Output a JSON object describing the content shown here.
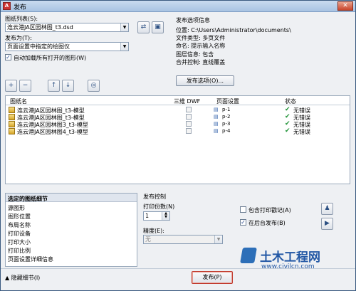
{
  "window": {
    "title": "发布",
    "close_glyph": "✕"
  },
  "sheet_list": {
    "label": "图纸列表(S):",
    "value": "连云港JA区园林图_t3.dsd"
  },
  "publish_to": {
    "label": "发布为(T):",
    "value": "页面设置中指定的绘图仪"
  },
  "auto_load": {
    "label": "自动加载所有打开的图形(W)",
    "checked": true
  },
  "info": {
    "title": "发布选项信息",
    "lines": [
      "位置: C:\\Users\\Administrator\\documents\\",
      "文件类型: 多页文件",
      "命名: 提示输入名称",
      "图层信息: 包含",
      "合并控制: 直线覆盖"
    ],
    "options_button": "发布选项(O)..."
  },
  "table": {
    "headers": [
      "图纸名",
      "三维 DWF",
      "页面设置",
      "状态"
    ],
    "rows": [
      {
        "name": "连云港JA区园林图_t3-模型",
        "setup": "p-1",
        "status": "无错误"
      },
      {
        "name": "连云港JA区园林图_t3-模型",
        "setup": "p-2",
        "status": "无错误"
      },
      {
        "name": "连云港JA区园林图3_t3-模型",
        "setup": "p-3",
        "status": "无错误"
      },
      {
        "name": "连云港JA区园林图4_t3-模型",
        "setup": "p-4",
        "status": "无错误"
      }
    ]
  },
  "details": {
    "title": "选定的图纸细节",
    "items": [
      "源图形",
      "图形位置",
      "布局名称",
      "打印设备",
      "打印大小",
      "打印比例",
      "页面设置详细信息"
    ],
    "hide_label": "隐藏细节(I)"
  },
  "publish_control": {
    "title": "发布控制",
    "copies_label": "打印份数(N)",
    "copies_value": "1",
    "precision_label": "精度(E):",
    "precision_value": "无",
    "stamp_label": "包含打印戳记(A)",
    "stamp_checked": false,
    "background_label": "在后台发布(B)",
    "background_checked": true
  },
  "footer": {
    "publish_button": "发布(P)"
  },
  "watermark": {
    "title": "土木工程网",
    "url": "www.civilcn.com"
  }
}
